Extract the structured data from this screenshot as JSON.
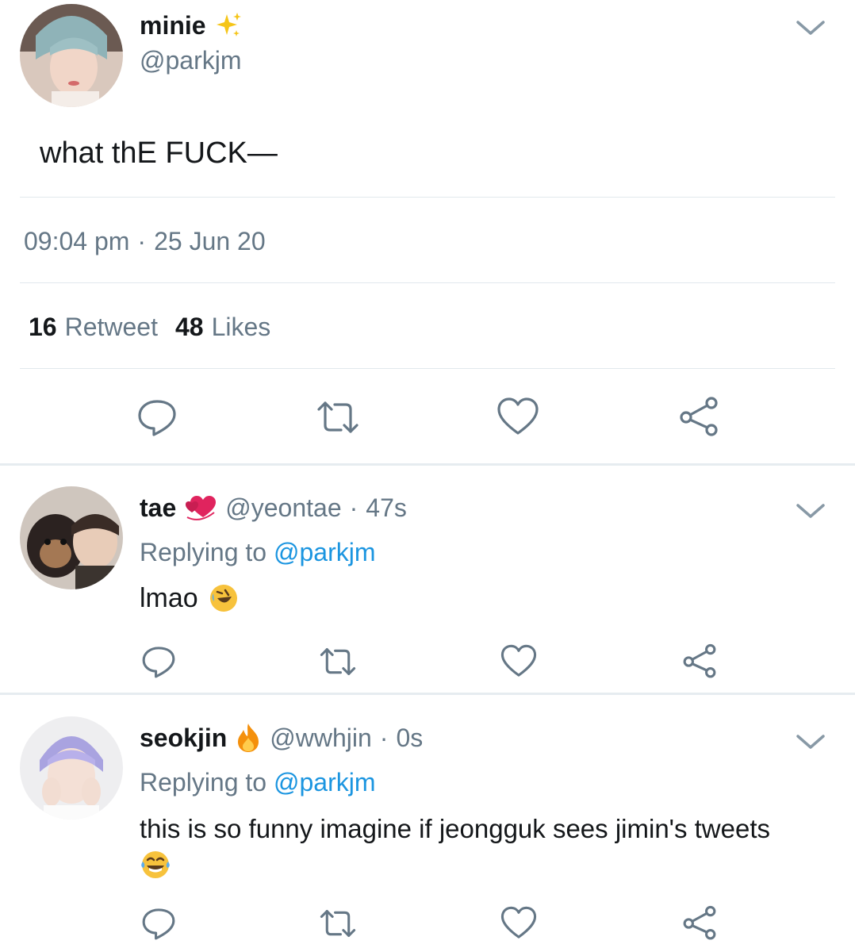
{
  "main_tweet": {
    "display_name": "minie",
    "name_emoji": "sparkles",
    "handle": "@parkjm",
    "text": "what thE FUCK—",
    "time": "09:04 pm",
    "separator": "·",
    "date": "25 Jun 20",
    "retweet_count": "16",
    "retweet_label": "Retweet",
    "likes_count": "48",
    "likes_label": "Likes"
  },
  "replies": [
    {
      "display_name": "tae",
      "name_emoji": "revolving-hearts",
      "handle": "@yeontae",
      "dot": "·",
      "time": "47s",
      "replying_label": "Replying to",
      "replying_handle": "@parkjm",
      "text": "lmao",
      "text_emoji": "rolling-on-floor-laughing"
    },
    {
      "display_name": "seokjin",
      "name_emoji": "fire",
      "handle": "@wwhjin",
      "dot": "·",
      "time": "0s",
      "replying_label": "Replying to",
      "replying_handle": "@parkjm",
      "text": "this is so funny imagine if jeongguk sees jimin's tweets",
      "text_emoji": "face-with-tears-of-joy"
    }
  ],
  "icons": [
    "reply-icon",
    "retweet-icon",
    "like-icon",
    "share-icon",
    "chevron-down-icon"
  ],
  "colors": {
    "text": "#14171a",
    "secondary": "#657786",
    "link": "#1b95e0",
    "divider": "#e1e8ed",
    "icon": "#657786"
  }
}
